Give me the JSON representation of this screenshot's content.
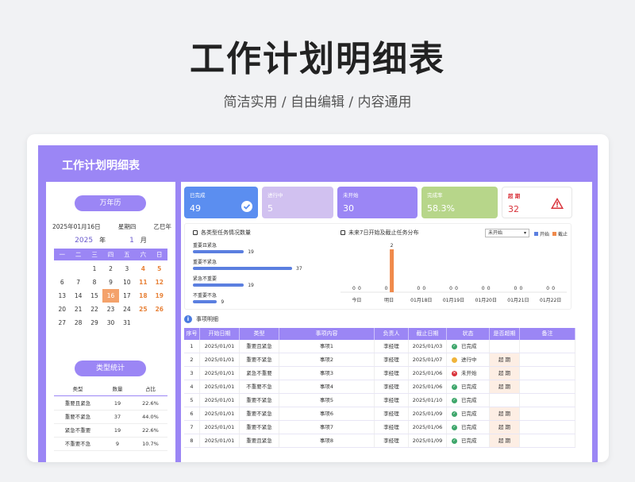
{
  "hero": {
    "title": "工作计划明细表",
    "subtitle": "简洁实用 / 自由编辑 / 内容通用"
  },
  "dashboard": {
    "title": "工作计划明细表"
  },
  "calendar": {
    "pill": "万年历",
    "date_text": "2025年01月16日",
    "weekday": "星期四",
    "ganzhi": "乙巳年",
    "year": "2025",
    "year_unit": "年",
    "month": "1",
    "month_unit": "月",
    "weekdays": [
      "一",
      "二",
      "三",
      "四",
      "五",
      "六",
      "日"
    ],
    "weeks": [
      [
        "",
        "",
        "1",
        "2",
        "3",
        "4",
        "5"
      ],
      [
        "6",
        "7",
        "8",
        "9",
        "10",
        "11",
        "12"
      ],
      [
        "13",
        "14",
        "15",
        "16",
        "17",
        "18",
        "19"
      ],
      [
        "20",
        "21",
        "22",
        "23",
        "24",
        "25",
        "26"
      ],
      [
        "27",
        "28",
        "29",
        "30",
        "31",
        "",
        ""
      ]
    ],
    "today": "16"
  },
  "type_stats": {
    "pill": "类型统计",
    "headers": [
      "类型",
      "数量",
      "占比"
    ],
    "rows": [
      [
        "重要且紧急",
        "19",
        "22.6%"
      ],
      [
        "重要不紧急",
        "37",
        "44.0%"
      ],
      [
        "紧急不重要",
        "19",
        "22.6%"
      ],
      [
        "不重要不急",
        "9",
        "10.7%"
      ]
    ]
  },
  "kpis": [
    {
      "label": "已完成",
      "value": "49",
      "color": "#5b8ef0"
    },
    {
      "label": "进行中",
      "value": "5",
      "color": "#d1c1f0"
    },
    {
      "label": "未开始",
      "value": "30",
      "color": "#9b86f5"
    },
    {
      "label": "完成率",
      "value": "58.3%",
      "color": "#b7d68a"
    },
    {
      "label": "超 期",
      "value": "32",
      "color": "#d9323a"
    }
  ],
  "type_chart": {
    "title": "各类型任务情况数量",
    "items": [
      {
        "label": "重要且紧急",
        "value": 19
      },
      {
        "label": "重要不紧急",
        "value": 37
      },
      {
        "label": "紧急不重要",
        "value": 19
      },
      {
        "label": "不重要不急",
        "value": 9
      }
    ],
    "max": 37
  },
  "chart_data": {
    "type": "bar",
    "title": "未来7日开始及截止任务分布",
    "categories": [
      "今日",
      "明日",
      "01月18日",
      "01月19日",
      "01月20日",
      "01月21日",
      "01月22日"
    ],
    "series": [
      {
        "name": "开始",
        "values": [
          0,
          0,
          0,
          0,
          0,
          0,
          0
        ],
        "color": "#5b7fe0"
      },
      {
        "name": "截止",
        "values": [
          0,
          2,
          0,
          0,
          0,
          0,
          0
        ],
        "color": "#f08a4b"
      }
    ],
    "ylim": [
      0,
      2
    ],
    "filter_value": "未开始",
    "legend_position": "top-right"
  },
  "detail": {
    "title": "事项明细",
    "headers": [
      "序号",
      "开始日期",
      "类型",
      "事项内容",
      "负责人",
      "截止日期",
      "状态",
      "是否超期",
      "备注"
    ],
    "rows": [
      {
        "no": "1",
        "start": "2025/01/01",
        "type": "重要且紧急",
        "content": "事项1",
        "owner": "李经理",
        "due": "2025/01/03",
        "status": "已完成",
        "status_color": "#3ea66b",
        "overdue": ""
      },
      {
        "no": "2",
        "start": "2025/01/01",
        "type": "重要不紧急",
        "content": "事项2",
        "owner": "李经理",
        "due": "2025/01/07",
        "status": "进行中",
        "status_color": "#f0b43c",
        "overdue": "超 期"
      },
      {
        "no": "3",
        "start": "2025/01/01",
        "type": "紧急不重要",
        "content": "事项3",
        "owner": "李经理",
        "due": "2025/01/06",
        "status": "未开始",
        "status_color": "#d9323a",
        "overdue": "超 期"
      },
      {
        "no": "4",
        "start": "2025/01/01",
        "type": "不重要不急",
        "content": "事项4",
        "owner": "李经理",
        "due": "2025/01/06",
        "status": "已完成",
        "status_color": "#3ea66b",
        "overdue": "超 期"
      },
      {
        "no": "5",
        "start": "2025/01/01",
        "type": "重要不紧急",
        "content": "事项5",
        "owner": "李经理",
        "due": "2025/01/10",
        "status": "已完成",
        "status_color": "#3ea66b",
        "overdue": ""
      },
      {
        "no": "6",
        "start": "2025/01/01",
        "type": "重要不紧急",
        "content": "事项6",
        "owner": "李经理",
        "due": "2025/01/09",
        "status": "已完成",
        "status_color": "#3ea66b",
        "overdue": "超 期"
      },
      {
        "no": "7",
        "start": "2025/01/01",
        "type": "重要不紧急",
        "content": "事项7",
        "owner": "李经理",
        "due": "2025/01/06",
        "status": "已完成",
        "status_color": "#3ea66b",
        "overdue": "超 期"
      },
      {
        "no": "8",
        "start": "2025/01/01",
        "type": "重要且紧急",
        "content": "事项8",
        "owner": "李经理",
        "due": "2025/01/09",
        "status": "已完成",
        "status_color": "#3ea66b",
        "overdue": "超 期"
      }
    ]
  }
}
